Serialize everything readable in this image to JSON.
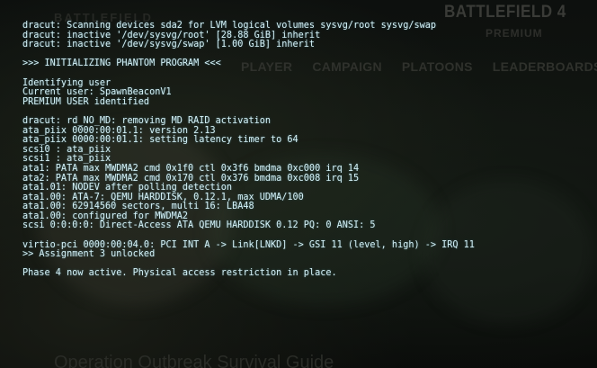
{
  "background_site": {
    "brand": "BATTLEFIELD",
    "logo": "BATTLEFIELD 4",
    "logo_sub": "PREMIUM",
    "nav": [
      "PLAYER",
      "CAMPAIGN",
      "PLATOONS",
      "LEADERBOARDS"
    ],
    "guide_title": "Operation Outbreak Survival Guide"
  },
  "terminal": {
    "block1": [
      "dracut: Scanning devices sda2 for LVM logical volumes sysvg/root sysvg/swap",
      "dracut: inactive '/dev/sysvg/root' [28.88 GiB] inherit",
      "dracut: inactive '/dev/sysvg/swap' [1.00 GiB] inherit"
    ],
    "banner": ">>> INITIALIZING PHANTOM PROGRAM <<<",
    "block2": [
      "Identifying user",
      "Current user: SpawnBeaconV1",
      "PREMIUM USER identified"
    ],
    "block3": [
      "dracut: rd_NO_MD: removing MD RAID activation",
      "ata_piix 0000:00:01.1: version 2.13",
      "ata_piix 0000:00:01.1: setting latency timer to 64",
      "scsi0 : ata_piix",
      "scsi1 : ata_piix",
      "ata1: PATA max MWDMA2 cmd 0x1f0 ctl 0x3f6 bmdma 0xc000 irq 14",
      "ata2: PATA max MWDMA2 cmd 0x170 ctl 0x376 bmdma 0xc008 irq 15",
      "ata1.01: NODEV after polling detection",
      "ata1.00: ATA-7: QEMU HARDDISK, 0.12.1, max UDMA/100",
      "ata1.00: 62914560 sectors, multi 16: LBA48",
      "ata1.00: configured for MWDMA2",
      "scsi 0:0:0:0: Direct-Access ATA QEMU HARDDISK 0.12 PQ: 0 ANSI: 5"
    ],
    "block4": [
      "virtio-pci 0000:00:04.0: PCI INT A -> Link[LNKD] -> GSI 11 (level, high) -> IRQ 11",
      ">> Assignment 3 unlocked"
    ],
    "status": "Phase 4 now active. Physical access restriction in place."
  },
  "colors": {
    "terminal_text": "#d5f2f8",
    "background": "#0b0d0c"
  }
}
